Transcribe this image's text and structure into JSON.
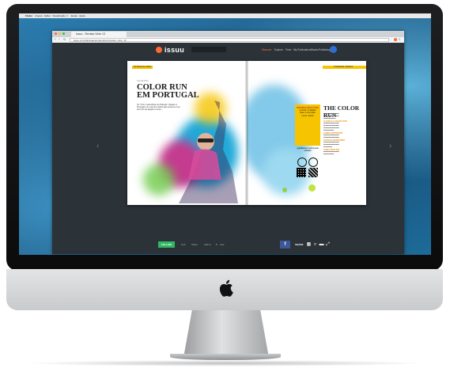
{
  "mac_menubar": {
    "items": [
      "Finder",
      "Arquivo",
      "Editar",
      "Visualização",
      "Ir",
      "Janela",
      "Ajuda"
    ]
  },
  "browser": {
    "tab_title": "Issuu - Revista Vinte 13",
    "url": "issuu.com/clarissamanzano/docs/revista_vinte_13"
  },
  "issuu_header": {
    "logo": "issuu",
    "nav": [
      "Discover",
      "Explore",
      "Feed",
      "My Publications",
      "Stacks",
      "Publishing"
    ]
  },
  "magazine": {
    "left_tag": "NOTÍCIAS DA VINTE",
    "left_small": "COLOR RUN",
    "left_title": "COLOR RUN EM PORTUGAL",
    "left_lede": "Os \"5 km mais felizes do Planeta\" chegam a Portugal e as ruas de Lisboa vão tornar-se num arco-íris de alegria e cores.",
    "right_tag": "PT BRANDS / EVENTS",
    "right_title": "THE COLOR RUN",
    "info_box": {
      "heading": "INFORMAÇÕES ÚTEIS",
      "lines": [
        "Corrida: 3ª Edição",
        "Data: 14 de Maio",
        "Local: Lisboa"
      ],
      "qr_caption": "QUEREMOS OUVIR A SUA OPINIÃO"
    },
    "subheads": [
      "O QUE É A COLOR RUN",
      "COMO PARTICIPAR",
      "OUTRAS NOVIDADES",
      "SAIBA MAIS EM"
    ]
  },
  "toolbar": {
    "follow_label": "FOLLOW",
    "items": [
      "Link",
      "Share",
      "Add to",
      "Like"
    ],
    "facebook_label": "f",
    "right_label": "SHARE"
  },
  "colors": {
    "issuu_orange": "#ff6a2f",
    "follow_green": "#2fb865",
    "facebook_blue": "#3b5998",
    "magazine_yellow": "#f6c400",
    "reader_bg": "#2b3238"
  }
}
